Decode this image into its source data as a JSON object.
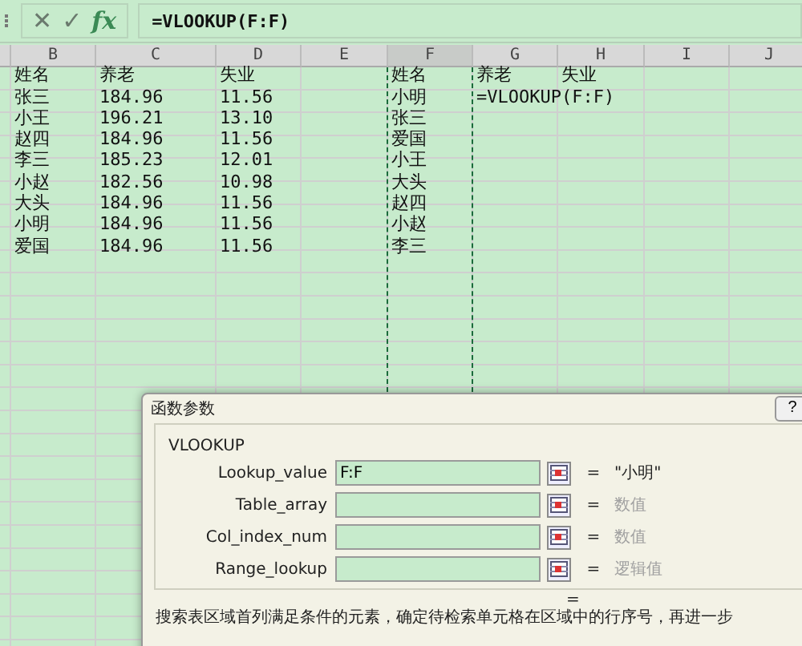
{
  "formula_bar": {
    "cancel": "✕",
    "confirm": "✓",
    "fx": "fx",
    "formula": "=VLOOKUP(F:F)"
  },
  "sheet": {
    "columns": [
      {
        "label": "B",
        "marquee": false
      },
      {
        "label": "C",
        "marquee": false
      },
      {
        "label": "D",
        "marquee": false
      },
      {
        "label": "E",
        "marquee": false
      },
      {
        "label": "F",
        "marquee": true
      },
      {
        "label": "G",
        "marquee": false
      },
      {
        "label": "H",
        "marquee": false
      },
      {
        "label": "I",
        "marquee": false
      },
      {
        "label": "J",
        "marquee": false
      }
    ],
    "rows": [
      {
        "B": "姓名",
        "C": "养老",
        "D": "失业",
        "F": "姓名",
        "G": "养老",
        "H": "失业"
      },
      {
        "B": "张三",
        "C": "184.96",
        "D": "11.56",
        "F": "小明",
        "G": "=VLOOKUP(F:F)"
      },
      {
        "B": "小王",
        "C": "196.21",
        "D": "13.10",
        "F": "张三"
      },
      {
        "B": "赵四",
        "C": "184.96",
        "D": "11.56",
        "F": "爱国"
      },
      {
        "B": "李三",
        "C": "185.23",
        "D": "12.01",
        "F": "小王"
      },
      {
        "B": "小赵",
        "C": "182.56",
        "D": "10.98",
        "F": "大头"
      },
      {
        "B": "大头",
        "C": "184.96",
        "D": "11.56",
        "F": "赵四"
      },
      {
        "B": "小明",
        "C": "184.96",
        "D": "11.56",
        "F": "小赵"
      },
      {
        "B": "爱国",
        "C": "184.96",
        "D": "11.56",
        "F": "李三"
      }
    ]
  },
  "dialog": {
    "title": "函数参数",
    "help": "?",
    "function": "VLOOKUP",
    "arguments": [
      {
        "label": "Lookup_value",
        "value": "F:F",
        "result": "\"小明\"",
        "result_hint": false
      },
      {
        "label": "Table_array",
        "result": "数值",
        "result_hint": true
      },
      {
        "label": "Col_index_num",
        "result": "数值",
        "result_hint": true
      },
      {
        "label": "Range_lookup",
        "result": "逻辑值",
        "result_hint": true
      }
    ],
    "equals": "=",
    "result_equals": "=",
    "description": "搜索表区域首列满足条件的元素，确定待检索单元格在区域中的行序号，再进一步"
  }
}
